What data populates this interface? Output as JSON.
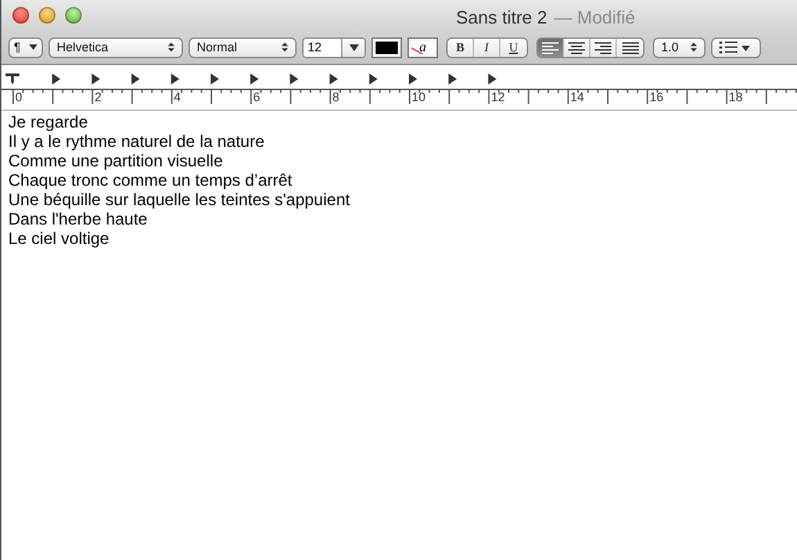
{
  "window": {
    "title": "Sans titre 2",
    "status": "— Modifié"
  },
  "toolbar": {
    "paragraph_button": "¶",
    "font": "Helvetica",
    "typeface": "Normal",
    "size": "12",
    "highlight_label": "a",
    "styles": [
      {
        "label": "B",
        "kind": "bold"
      },
      {
        "label": "I",
        "kind": "italic"
      },
      {
        "label": "U",
        "kind": "underline"
      }
    ],
    "alignment": [
      {
        "kind": "left",
        "selected": true
      },
      {
        "kind": "center",
        "selected": false
      },
      {
        "kind": "right",
        "selected": false
      },
      {
        "kind": "justify",
        "selected": false
      }
    ],
    "spacing": "1.0"
  },
  "ruler": {
    "labels": [
      "0",
      "2",
      "4",
      "6",
      "8",
      "10",
      "12",
      "14",
      "16",
      "18"
    ]
  },
  "document": {
    "lines": [
      "Je regarde",
      "Il y a le rythme naturel de la nature",
      "Comme une partition visuelle",
      "Chaque tronc comme un temps d’arrêt",
      "Une béquille sur laquelle les teintes s'appuient",
      "Dans l'herbe haute",
      "Le ciel voltige"
    ]
  }
}
